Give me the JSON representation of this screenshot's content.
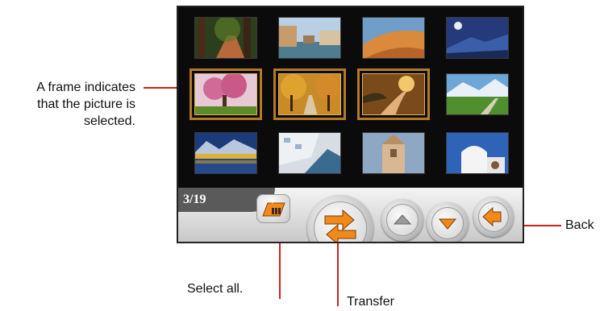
{
  "callouts": {
    "frame_note": [
      "A frame indicates",
      "that the picture is",
      "selected."
    ],
    "back": "Back",
    "select_all": "Select all.",
    "transfer": "Transfer"
  },
  "toolbar": {
    "counter": "3/19"
  },
  "thumbnails": [
    {
      "name": "forest-path",
      "selected": false
    },
    {
      "name": "venice-canal",
      "selected": false
    },
    {
      "name": "desert-dunes",
      "selected": false
    },
    {
      "name": "mountain-moon",
      "selected": false
    },
    {
      "name": "cherry-blossom-tree",
      "selected": true
    },
    {
      "name": "autumn-avenue",
      "selected": true
    },
    {
      "name": "country-road",
      "selected": true
    },
    {
      "name": "mountain-valley",
      "selected": false
    },
    {
      "name": "lake-mountains",
      "selected": false
    },
    {
      "name": "coastal-town",
      "selected": false
    },
    {
      "name": "bell-tower-church",
      "selected": false
    },
    {
      "name": "white-chapel",
      "selected": false
    }
  ],
  "colors": {
    "leader": "#d0211b",
    "selection_frame": "#b37a2a",
    "accent_orange": "#f28a1a"
  }
}
